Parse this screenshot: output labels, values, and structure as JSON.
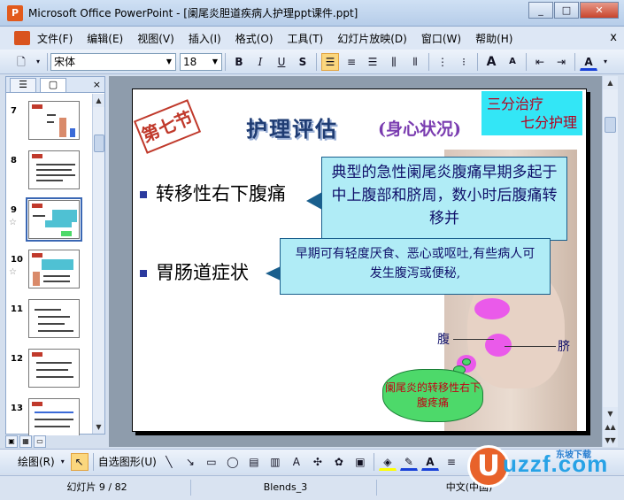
{
  "window": {
    "title": "Microsoft Office PowerPoint - [阑尾炎胆道疾病人护理ppt课件.ppt]",
    "min": "_",
    "max": "□",
    "close": "✕"
  },
  "menu": [
    "文件(F)",
    "编辑(E)",
    "视图(V)",
    "插入(I)",
    "格式(O)",
    "工具(T)",
    "幻灯片放映(D)",
    "窗口(W)",
    "帮助(H)"
  ],
  "menu_close": "x",
  "toolbar": {
    "font": "宋体",
    "size": "18",
    "bold": "B",
    "italic": "I",
    "underline": "U",
    "shadow": "S",
    "grow": "A",
    "shrink": "A",
    "font_color": "A"
  },
  "thumbnails": [
    {
      "num": "7",
      "star": ""
    },
    {
      "num": "8",
      "star": ""
    },
    {
      "num": "9",
      "star": "☆"
    },
    {
      "num": "10",
      "star": "☆"
    },
    {
      "num": "11",
      "star": ""
    },
    {
      "num": "12",
      "star": ""
    },
    {
      "num": "13",
      "star": ""
    }
  ],
  "slide": {
    "section": "第七节",
    "title": "护理评估",
    "subtitle": "(身心状况)",
    "motto": {
      "line1": "三分治疗",
      "line2": "七分护理"
    },
    "bullets": [
      "转移性右下腹痛",
      "胃肠道症状"
    ],
    "callout1": "典型的急性阑尾炎腹痛早期多起于中上腹部和脐周，数小时后腹痛转移并",
    "callout2": "早期可有轻度厌食、恶心或呕吐,有些病人可发生腹泻或便秘,",
    "label_fu": "腹",
    "label_qi": "脐",
    "cloud_text": "阑尾炎的转移性右下腹疼痛"
  },
  "drawbar": {
    "draw": "绘图(R)",
    "autoshape": "自选图形(U)"
  },
  "status": {
    "slide": "幻灯片 9 / 82",
    "design": "Blends_3",
    "lang": "中文(中国)"
  },
  "logo": {
    "icon": "U",
    "text": "uzzf.com",
    "sub": "东坡下载"
  }
}
